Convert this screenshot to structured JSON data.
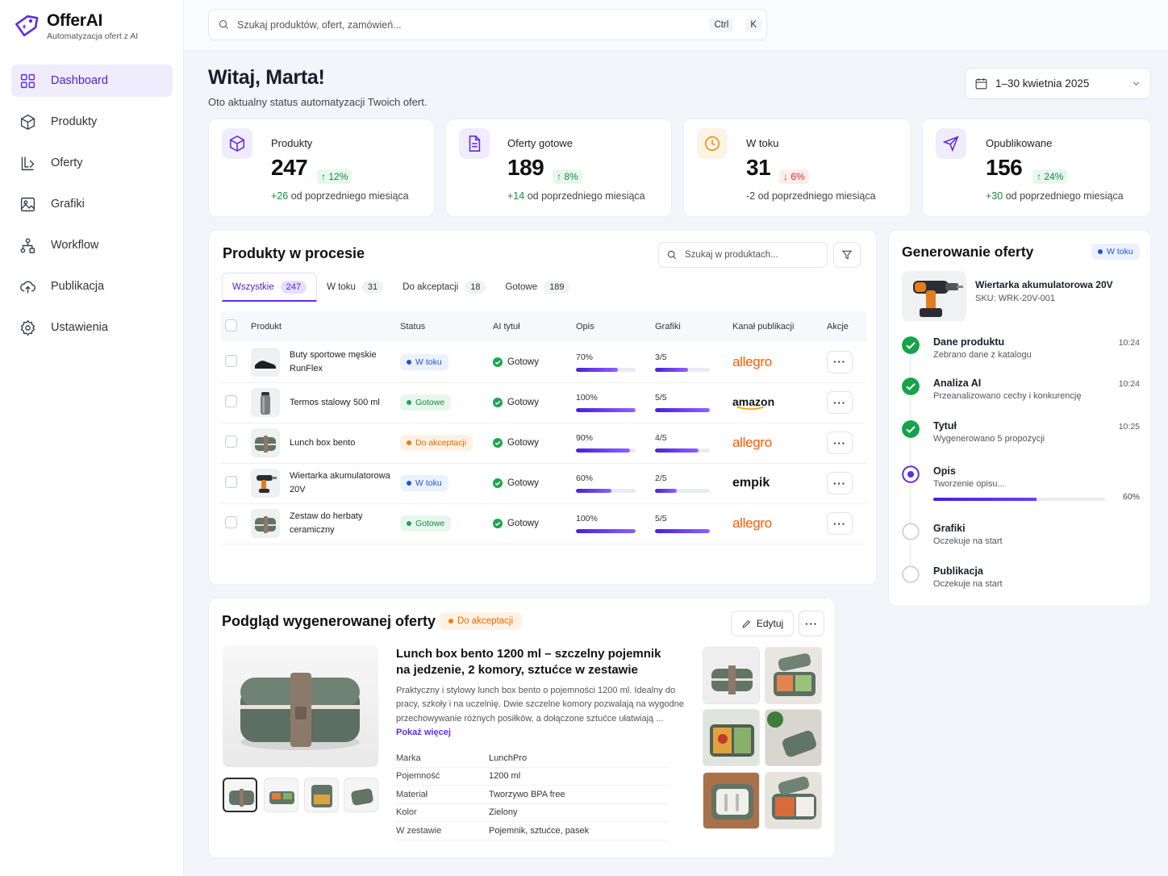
{
  "app": {
    "name": "OfferAI",
    "tagline": "Automatyzacja ofert z AI"
  },
  "sidebar": {
    "items": [
      {
        "label": "Dashboard",
        "icon": "grid-icon",
        "active": true
      },
      {
        "label": "Produkty",
        "icon": "box-icon"
      },
      {
        "label": "Oferty",
        "icon": "offers-icon"
      },
      {
        "label": "Grafiki",
        "icon": "image-icon"
      },
      {
        "label": "Workflow",
        "icon": "workflow-icon"
      },
      {
        "label": "Publikacja",
        "icon": "cloud-upload-icon"
      },
      {
        "label": "Ustawienia",
        "icon": "gear-icon"
      }
    ]
  },
  "search": {
    "placeholder": "Szukaj produktów, ofert, zamówień...",
    "shortcut": [
      "Ctrl",
      "K"
    ]
  },
  "header": {
    "greeting": "Witaj, Marta!",
    "subtitle": "Oto aktualny status automatyzacji Twoich ofert.",
    "date_range": "1–30 kwietnia 2025"
  },
  "kpis": [
    {
      "label": "Produkty",
      "value": "247",
      "delta": "12%",
      "dir": "up",
      "change": "+26",
      "change_text": " od poprzedniego miesiąca",
      "color": "#5b2ee0",
      "bg": "#f0ecfe"
    },
    {
      "label": "Oferty gotowe",
      "value": "189",
      "delta": "8%",
      "dir": "up",
      "change": "+14",
      "change_text": " od poprzedniego miesiąca",
      "color": "#5b2ee0",
      "bg": "#f0ecfe"
    },
    {
      "label": "W toku",
      "value": "31",
      "delta": "6%",
      "dir": "down",
      "change": "-2",
      "change_text": " od poprzedniego miesiąca",
      "color": "#f08a00",
      "bg": "#fff3e6"
    },
    {
      "label": "Opublikowane",
      "value": "156",
      "delta": "24%",
      "dir": "up",
      "change": "+30",
      "change_text": " od poprzedniego miesiąca",
      "color": "#5b2ee0",
      "bg": "#f0ecfe"
    }
  ],
  "process": {
    "title": "Produkty w procesie",
    "search_placeholder": "Szukaj w produktach...",
    "tabs": [
      {
        "label": "Wszystkie",
        "count": "247"
      },
      {
        "label": "W toku",
        "count": "31"
      },
      {
        "label": "Do akceptacji",
        "count": "18"
      },
      {
        "label": "Gotowe",
        "count": "189"
      }
    ],
    "columns": [
      "Produkt",
      "Status",
      "AI tytuł",
      "Opis",
      "Grafiki",
      "Kanał publikacji",
      "Akcje"
    ],
    "rows": [
      {
        "name": "Buty sportowe męskie RunFlex",
        "status": "W toku",
        "status_kind": "blue",
        "ai": "Gotowy",
        "opis": "70%",
        "opis_val": 0.7,
        "grafiki": "3/5",
        "graf_val": 0.6,
        "channel": "allegro",
        "thumb": "shoe"
      },
      {
        "name": "Termos stalowy 500 ml",
        "status": "Gotowe",
        "status_kind": "green",
        "ai": "Gotowy",
        "opis": "100%",
        "opis_val": 1.0,
        "grafiki": "5/5",
        "graf_val": 1.0,
        "channel": "amazon",
        "thumb": "thermos"
      },
      {
        "name": "Lunch box bento",
        "status": "Do akceptacji",
        "status_kind": "orange",
        "ai": "Gotowy",
        "opis": "90%",
        "opis_val": 0.9,
        "grafiki": "4/5",
        "graf_val": 0.8,
        "channel": "allegro",
        "thumb": "bento"
      },
      {
        "name": "Wiertarka akumulatorowa 20V",
        "status": "W toku",
        "status_kind": "blue",
        "ai": "Gotowy",
        "opis": "60%",
        "opis_val": 0.6,
        "grafiki": "2/5",
        "graf_val": 0.4,
        "channel": "empik",
        "thumb": "drill"
      },
      {
        "name": "Zestaw do herbaty ceramiczny",
        "status": "Gotowe",
        "status_kind": "green",
        "ai": "Gotowy",
        "opis": "100%",
        "opis_val": 1.0,
        "grafiki": "5/5",
        "graf_val": 1.0,
        "channel": "allegro",
        "thumb": "bento"
      }
    ]
  },
  "generation": {
    "title": "Generowanie oferty",
    "badge": "W toku",
    "product": "Wiertarka akumulatorowa 20V",
    "sku": "SKU: WRK-20V-001",
    "steps": [
      {
        "title": "Dane produktu",
        "desc": "Zebrano dane z katalogu",
        "time": "10:24",
        "state": "done"
      },
      {
        "title": "Analiza AI",
        "desc": "Przeanalizowano cechy i konkurencję",
        "time": "10:24",
        "state": "done"
      },
      {
        "title": "Tytuł",
        "desc": "Wygenerowano 5 propozycji",
        "time": "10:25",
        "state": "done"
      },
      {
        "title": "Opis",
        "desc": "Tworzenie opisu...",
        "time": "",
        "state": "active",
        "progress": "60%",
        "progress_val": 0.6
      },
      {
        "title": "Grafiki",
        "desc": "Oczekuje na start",
        "time": "",
        "state": "pending"
      },
      {
        "title": "Publikacja",
        "desc": "Oczekuje na start",
        "time": "",
        "state": "pending"
      }
    ]
  },
  "preview": {
    "title": "Podgląd wygenerowanej oferty",
    "badge": "Do akceptacji",
    "edit_label": "Edytuj",
    "offer_title": "Lunch box bento 1200 ml – szczelny pojemnik na jedzenie, 2 komory, sztućce w zestawie",
    "offer_title_1": "Lunch box bento 1200 ml – szczelny pojemnik",
    "offer_title_2": "na jedzenie, 2 komory, sztućce w zestawie",
    "description": "Praktyczny i stylowy lunch box bento o pojemności 1200 ml. Idealny do pracy, szkoły i na uczelnię. Dwie szczelne komory pozwalają na wygodne przechowywanie różnych posiłków, a dołączone sztućce ułatwiają ...",
    "more": "Pokaż więcej",
    "specs": [
      {
        "k": "Marka",
        "v": "LunchPro"
      },
      {
        "k": "Pojemność",
        "v": "1200 ml"
      },
      {
        "k": "Materiał",
        "v": "Tworzywo BPA free"
      },
      {
        "k": "Kolor",
        "v": "Zielony"
      },
      {
        "k": "W zestawie",
        "v": "Pojemnik, sztućce, pasek"
      }
    ]
  }
}
